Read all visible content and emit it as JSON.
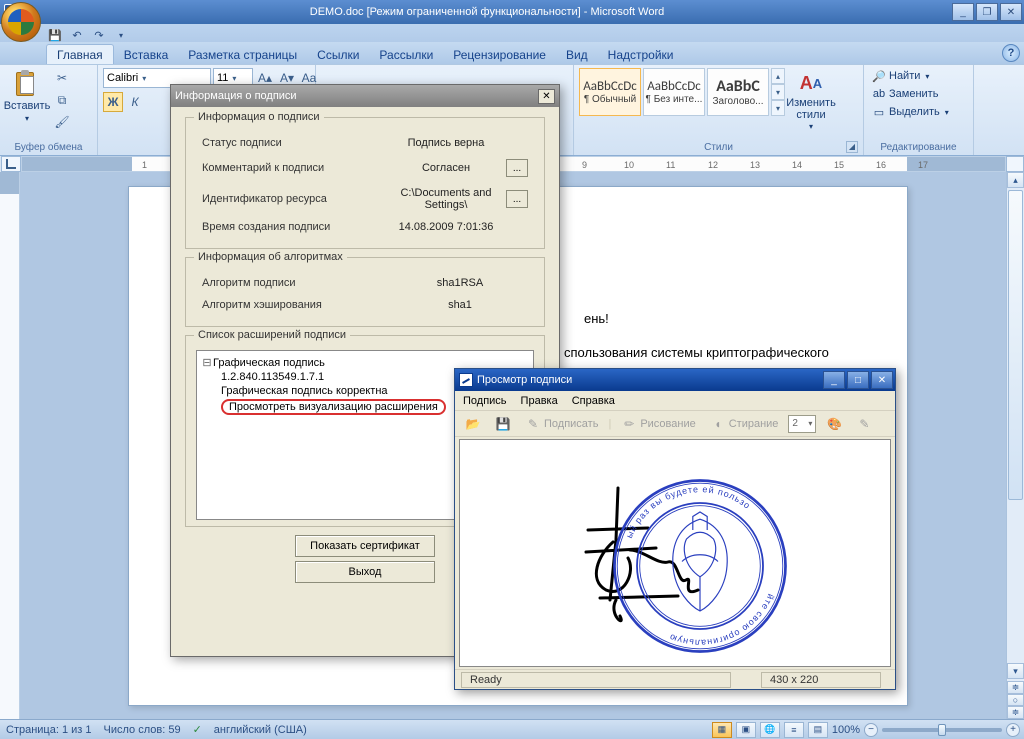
{
  "app": {
    "doc_icon": "W",
    "title": "DEMO.doc [Режим ограниченной функциональности] - Microsoft Word"
  },
  "ribbon_tabs": [
    "Главная",
    "Вставка",
    "Разметка страницы",
    "Ссылки",
    "Рассылки",
    "Рецензирование",
    "Вид",
    "Надстройки"
  ],
  "active_tab_index": 0,
  "groups": {
    "clipboard": {
      "label": "Буфер обмена",
      "paste": "Вставить"
    },
    "font": {
      "name": "Calibri",
      "size": "11"
    },
    "styles": {
      "label": "Стили",
      "change": "Изменить стили",
      "items": [
        {
          "preview": "AaBbCcDc",
          "name": "¶ Обычный",
          "selected": true
        },
        {
          "preview": "AaBbCcDc",
          "name": "¶ Без инте..."
        },
        {
          "preview": "AaBbC",
          "name": "Заголово..."
        }
      ]
    },
    "editing": {
      "label": "Редактирование",
      "find": "Найти",
      "replace": "Заменить",
      "select": "Выделить"
    }
  },
  "ruler_labels": [
    "9",
    "10",
    "11",
    "12",
    "13",
    "14",
    "15",
    "16",
    "17"
  ],
  "doc": {
    "line1": "ень!",
    "line2": "спользования  системы  криптографического"
  },
  "statusbar": {
    "page": "Страница: 1 из 1",
    "words": "Число слов: 59",
    "lang": "английский (США)",
    "zoom": "100%"
  },
  "dialog1": {
    "title": "Информация о подписи",
    "g1": "Информация о подписи",
    "rows1": [
      {
        "k": "Статус подписи",
        "v": "Подпись верна",
        "dots": false
      },
      {
        "k": "Комментарий к подписи",
        "v": "Согласен",
        "dots": true
      },
      {
        "k": "Идентификатор ресурса",
        "v": "C:\\Documents and Settings\\",
        "dots": true
      },
      {
        "k": "Время создания подписи",
        "v": "14.08.2009 7:01:36",
        "dots": false
      }
    ],
    "g2": "Информация об алгоритмах",
    "rows2": [
      {
        "k": "Алгоритм подписи",
        "v": "sha1RSA"
      },
      {
        "k": "Алгоритм хэширования",
        "v": "sha1"
      }
    ],
    "g3": "Список расширений подписи",
    "tree": {
      "root": "Графическая подпись",
      "oid": "1.2.840.113549.1.7.1",
      "correct": "Графическая подпись корректна",
      "view": "Просмотреть визуализацию расширения"
    },
    "btn_cert": "Показать сертификат",
    "btn_exit": "Выход"
  },
  "win2": {
    "title": "Просмотр подписи",
    "menu": [
      "Подпись",
      "Правка",
      "Справка"
    ],
    "toolbar": {
      "sign": "Подписать",
      "draw": "Рисование",
      "erase": "Стирание",
      "width": "2"
    },
    "status_left": "Ready",
    "status_right": "430 x 220"
  }
}
